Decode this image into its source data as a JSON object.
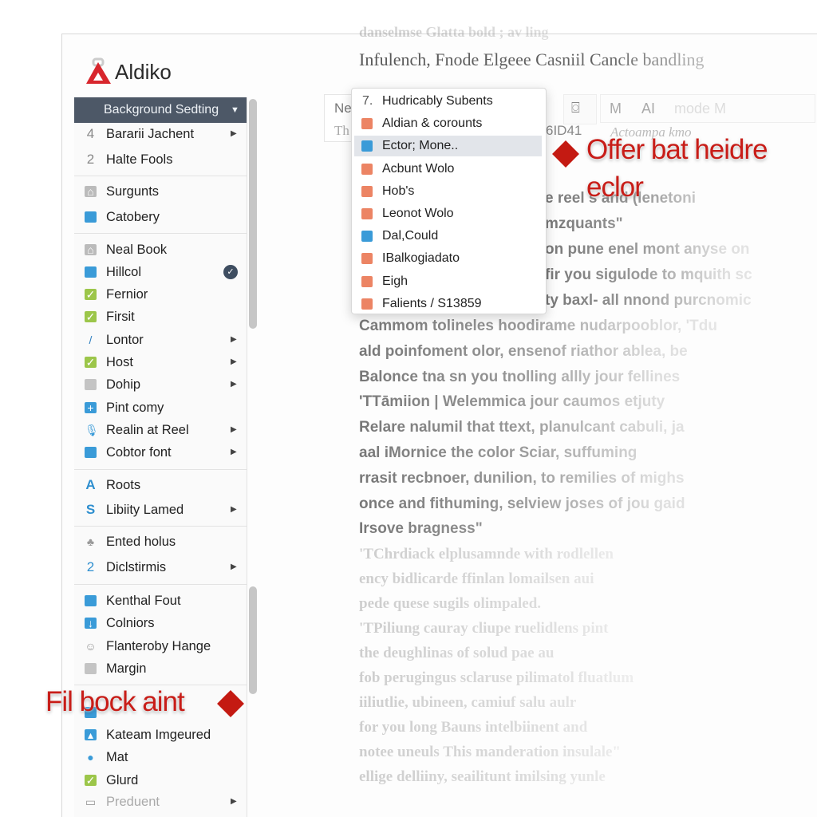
{
  "app": {
    "name": "Aldiko",
    "accent": "#d8262d"
  },
  "sidebar": {
    "selected": {
      "label": "Background Sedting",
      "icon": "caret-down-icon"
    },
    "items": [
      {
        "prefix": "4",
        "label": "Bararii Jachent",
        "arrow": true
      },
      {
        "prefix": "2",
        "label": "Halte Fools"
      },
      {
        "label": "Surgunts",
        "icon": "home-icon"
      },
      {
        "label": "Catobery",
        "icon": "folder-icon"
      },
      {
        "label": "Neal Book",
        "icon": "home-icon"
      },
      {
        "label": "Hillcol",
        "icon": "file-icon",
        "checked": true
      },
      {
        "label": "Fernior",
        "icon": "check-icon"
      },
      {
        "label": "Firsit",
        "icon": "check-icon"
      },
      {
        "label": "Lontor",
        "icon": "pen-icon",
        "arrow": true
      },
      {
        "label": "Host",
        "icon": "check-icon",
        "arrow": true
      },
      {
        "label": "Dohip",
        "icon": "box-icon",
        "arrow": true
      },
      {
        "label": "Pint comy",
        "icon": "plus-icon"
      },
      {
        "label": "Realin at Reel",
        "icon": "mic-icon",
        "arrow": true
      },
      {
        "label": "Cobtor font",
        "icon": "folder-icon",
        "arrow": true
      },
      {
        "prefix": "A",
        "label": "Roots"
      },
      {
        "prefix": "S",
        "label": "Libiity Lamed",
        "arrow": true
      },
      {
        "label": "Ented holus",
        "icon": "network-icon"
      },
      {
        "prefix": "2",
        "label": "Diclstirmis",
        "arrow": true
      },
      {
        "label": "Kenthal Fout",
        "icon": "folder-icon"
      },
      {
        "label": "Colniors",
        "icon": "download-icon"
      },
      {
        "label": "Flanteroby Hange",
        "icon": "face-icon"
      },
      {
        "label": "Margin",
        "icon": "box-icon"
      },
      {
        "label": "Kateam Imgeured",
        "icon": "image-icon"
      },
      {
        "label": "Mat",
        "icon": "pin-icon"
      },
      {
        "label": "Glurd",
        "icon": "check-icon"
      },
      {
        "label": "Preduent",
        "icon": "window-icon",
        "arrow": true
      }
    ]
  },
  "dropdown": {
    "items": [
      {
        "label": "Hudricably Subents",
        "prefix": "7."
      },
      {
        "label": "Aldian & corounts"
      },
      {
        "label": "Ector; Mone..",
        "selected": true
      },
      {
        "label": "Acbunt Wolo"
      },
      {
        "label": "Hob's"
      },
      {
        "label": "Leonot Wolo"
      },
      {
        "label": "Dal,Could"
      },
      {
        "label": "IBalkogiadato"
      },
      {
        "label": "Eigh"
      },
      {
        "label": "Falients / S13859"
      }
    ]
  },
  "toolbar": {
    "left_top": "Ne",
    "left_bottom": "Th",
    "code": "6ID41",
    "btn_m": "M",
    "btn_ai": "AI",
    "mode": "mode M",
    "italic": "Actoampa kmo"
  },
  "document": {
    "top_line": "danselmse Glatta bold ; av ling",
    "heading": "Infulench, Fnode Elgeee Casniil Cancle bandling",
    "lines": [
      "e reel         s and  (lenetoni",
      "mzquants\"",
      "on pune enel mont anyse on",
      "fir you sigulode to mquith sc",
      "ty baxl- all nnond purcnomic",
      "Cammom tolineles hoodirame nudarpooblor, 'Tdu",
      "ald poinfoment olor, ensenof riathor ablea, be",
      "Balonce tna sn you tnolling allly jour fellines",
      "'TTāmiion | Welemmica jour caumos etjuty",
      "Relare nalumil that ttext, planulcant cabuli, ja",
      "aal iMornice the color Sciar, suffuming",
      "rrasit recbnoer, dunilion, to remilies of mighs",
      "once and fithuming, selview joses of jou gaid",
      "Irsove bragness\""
    ],
    "faint_lines": [
      "   'TChrdiack elplusamnde with rodlellen",
      "ency bidlicarde ffinlan lomailsen aui",
      "pede quese sugils olimpaled.",
      "   'TPiliung cauray cliupe ruelidlens pint",
      "the deughlinas of solud pae au",
      "fob perugingus sclaruse pilimatol fluatlum",
      "iiliutlie, ubineen, camiuf salu aulr",
      "for you long Bauns intelbiinent and",
      "notee uneuls This manderation insulale\"",
      "ellige delliiny, seailitunt imilsing yunle"
    ]
  },
  "annotations": {
    "top": [
      "Offer bat heidre",
      "eclor"
    ],
    "bottom": "Fil bock aint",
    "color": "#c81d18"
  }
}
